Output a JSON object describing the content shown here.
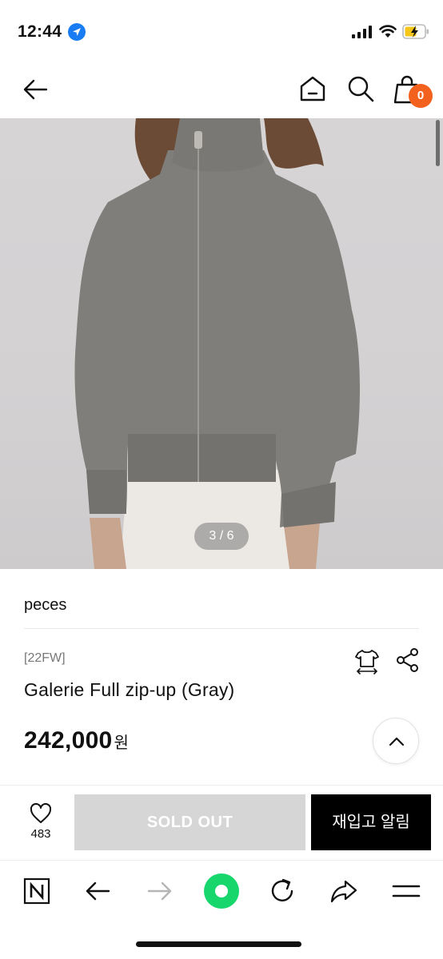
{
  "status_bar": {
    "time": "12:44"
  },
  "nav": {
    "cart_count": "0"
  },
  "product": {
    "image_indicator": "3 / 6",
    "brand": "peces",
    "season": "[22FW]",
    "title": "Galerie Full zip-up (Gray)",
    "price": "242,000",
    "currency": "원"
  },
  "actions": {
    "like_count": "483",
    "soldout_label": "SOLD OUT",
    "restock_label": "재입고 알림"
  },
  "colors": {
    "badge": "#f2611d",
    "sweater": "#807e7b",
    "browser_green": "#17d66c"
  },
  "browser_toolbar": {
    "icons": [
      "naver-n-icon",
      "back-arrow-icon",
      "forward-arrow-icon",
      "green-dot-icon",
      "refresh-icon",
      "share-arrow-icon",
      "menu-icon"
    ]
  }
}
